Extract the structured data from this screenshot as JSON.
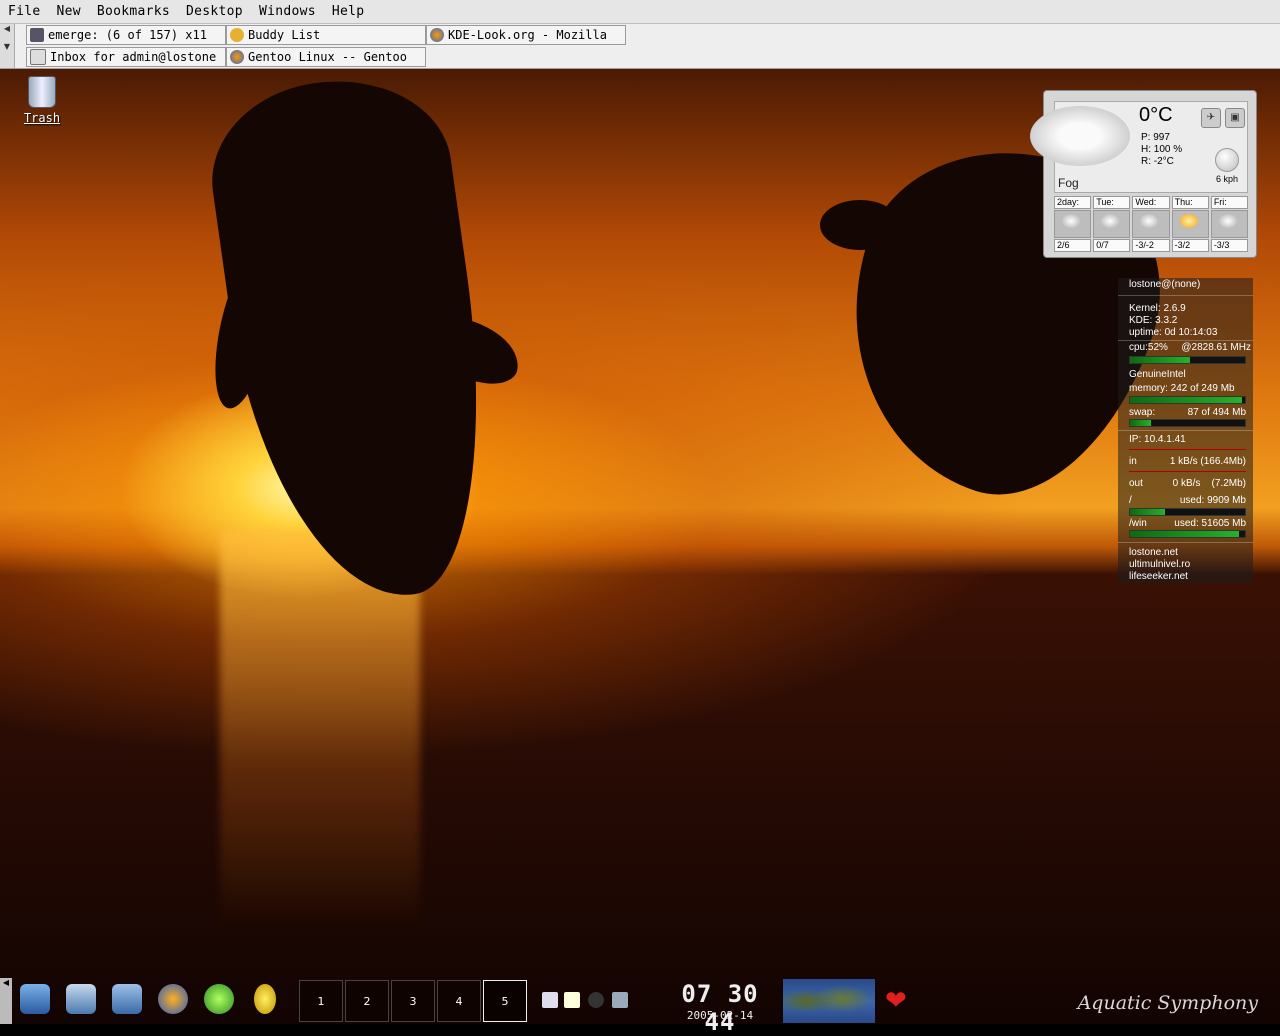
{
  "menubar": {
    "items": [
      "File",
      "New",
      "Bookmarks",
      "Desktop",
      "Windows",
      "Help"
    ]
  },
  "taskbar": {
    "tasks": [
      {
        "label": "emerge: (6 of 157) x11",
        "icon": "terminal-icon"
      },
      {
        "label": "Buddy List",
        "icon": "gaim-icon"
      },
      {
        "label": "KDE-Look.org - Mozilla",
        "icon": "firefox-icon"
      },
      {
        "label": "Inbox for admin@lostone",
        "icon": "mail-icon"
      },
      {
        "label": "Gentoo Linux -- Gentoo",
        "icon": "firefox-icon"
      }
    ]
  },
  "desktop": {
    "trash_label": "Trash"
  },
  "weather": {
    "temperature": "0°C",
    "pressure": "P: 997",
    "humidity": "H: 100 %",
    "realfeel": "R: -2°C",
    "condition": "Fog",
    "wind": "6 kph",
    "forecast": [
      {
        "day": "2day:",
        "temp": "2/6",
        "icon": "snow-icon"
      },
      {
        "day": "Tue:",
        "temp": "0/7",
        "icon": "cloud-icon"
      },
      {
        "day": "Wed:",
        "temp": "-3/-2",
        "icon": "snow-icon"
      },
      {
        "day": "Thu:",
        "temp": "-3/2",
        "icon": "sun-icon"
      },
      {
        "day": "Fri:",
        "temp": "-3/3",
        "icon": "snow-icon"
      }
    ]
  },
  "sysmon": {
    "user": "lostone@(none)",
    "kernel": "Kernel: 2.6.9",
    "kde": "KDE: 3.3.2",
    "uptime": "uptime: 0d 10:14:03",
    "cpu_label": "cpu:52%",
    "cpu_freq": "@2828.61 MHz",
    "cpu_usage": 0.52,
    "cpu_vendor": "GenuineIntel",
    "memory_label": "memory: 242 of 249 Mb",
    "memory_usage": 0.97,
    "swap_label": "swap:",
    "swap_value": "87 of 494 Mb",
    "swap_usage": 0.18,
    "ip": "IP: 10.4.1.41",
    "net_in_label": "in",
    "net_in_value": "1 kB/s (166.4Mb)",
    "net_out_label": "out",
    "net_out_value": "0 kB/s    (7.2Mb)",
    "root_label": "/",
    "root_value": "used: 9909 Mb",
    "root_usage": 0.3,
    "win_label": "/win",
    "win_value": "used: 51605 Mb",
    "win_usage": 0.95,
    "links": [
      "lostone.net",
      "ultimulnivel.ro",
      "lifeseeker.net"
    ]
  },
  "panel": {
    "desktops": [
      "1",
      "2",
      "3",
      "4",
      "5"
    ],
    "active_desktop": "5",
    "clock_time": "07 30 44",
    "clock_date": "2005-02-14",
    "theme_name": "Aquatic Symphony"
  }
}
